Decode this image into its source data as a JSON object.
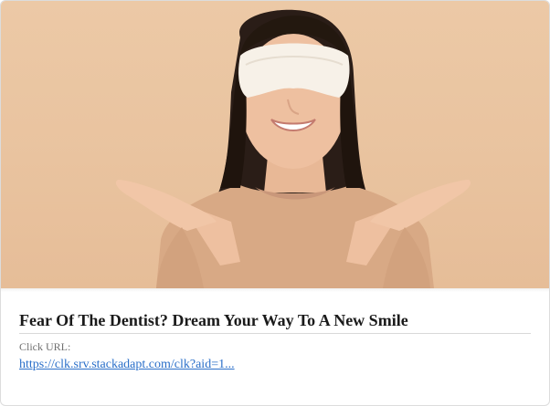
{
  "ad": {
    "image_alt": "Smiling woman wearing a white sleep mask over her eyes with palms open",
    "title": "Fear Of The Dentist? Dream Your Way To A New Smile",
    "url_label": "Click URL:",
    "url_text": "https://clk.srv.stackadapt.com/clk?aid=1..."
  },
  "colors": {
    "background": "#e9c39f",
    "link": "#2a6fc9",
    "title": "#1a1a1a"
  }
}
